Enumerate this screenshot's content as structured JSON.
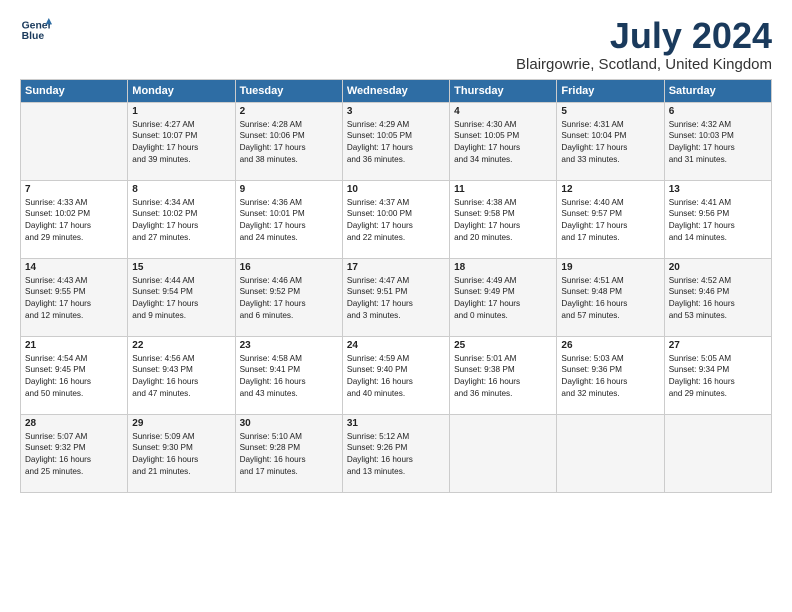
{
  "logo": {
    "line1": "General",
    "line2": "Blue"
  },
  "title": "July 2024",
  "location": "Blairgowrie, Scotland, United Kingdom",
  "days_header": [
    "Sunday",
    "Monday",
    "Tuesday",
    "Wednesday",
    "Thursday",
    "Friday",
    "Saturday"
  ],
  "weeks": [
    [
      {
        "day": "",
        "content": ""
      },
      {
        "day": "1",
        "content": "Sunrise: 4:27 AM\nSunset: 10:07 PM\nDaylight: 17 hours\nand 39 minutes."
      },
      {
        "day": "2",
        "content": "Sunrise: 4:28 AM\nSunset: 10:06 PM\nDaylight: 17 hours\nand 38 minutes."
      },
      {
        "day": "3",
        "content": "Sunrise: 4:29 AM\nSunset: 10:05 PM\nDaylight: 17 hours\nand 36 minutes."
      },
      {
        "day": "4",
        "content": "Sunrise: 4:30 AM\nSunset: 10:05 PM\nDaylight: 17 hours\nand 34 minutes."
      },
      {
        "day": "5",
        "content": "Sunrise: 4:31 AM\nSunset: 10:04 PM\nDaylight: 17 hours\nand 33 minutes."
      },
      {
        "day": "6",
        "content": "Sunrise: 4:32 AM\nSunset: 10:03 PM\nDaylight: 17 hours\nand 31 minutes."
      }
    ],
    [
      {
        "day": "7",
        "content": "Sunrise: 4:33 AM\nSunset: 10:02 PM\nDaylight: 17 hours\nand 29 minutes."
      },
      {
        "day": "8",
        "content": "Sunrise: 4:34 AM\nSunset: 10:02 PM\nDaylight: 17 hours\nand 27 minutes."
      },
      {
        "day": "9",
        "content": "Sunrise: 4:36 AM\nSunset: 10:01 PM\nDaylight: 17 hours\nand 24 minutes."
      },
      {
        "day": "10",
        "content": "Sunrise: 4:37 AM\nSunset: 10:00 PM\nDaylight: 17 hours\nand 22 minutes."
      },
      {
        "day": "11",
        "content": "Sunrise: 4:38 AM\nSunset: 9:58 PM\nDaylight: 17 hours\nand 20 minutes."
      },
      {
        "day": "12",
        "content": "Sunrise: 4:40 AM\nSunset: 9:57 PM\nDaylight: 17 hours\nand 17 minutes."
      },
      {
        "day": "13",
        "content": "Sunrise: 4:41 AM\nSunset: 9:56 PM\nDaylight: 17 hours\nand 14 minutes."
      }
    ],
    [
      {
        "day": "14",
        "content": "Sunrise: 4:43 AM\nSunset: 9:55 PM\nDaylight: 17 hours\nand 12 minutes."
      },
      {
        "day": "15",
        "content": "Sunrise: 4:44 AM\nSunset: 9:54 PM\nDaylight: 17 hours\nand 9 minutes."
      },
      {
        "day": "16",
        "content": "Sunrise: 4:46 AM\nSunset: 9:52 PM\nDaylight: 17 hours\nand 6 minutes."
      },
      {
        "day": "17",
        "content": "Sunrise: 4:47 AM\nSunset: 9:51 PM\nDaylight: 17 hours\nand 3 minutes."
      },
      {
        "day": "18",
        "content": "Sunrise: 4:49 AM\nSunset: 9:49 PM\nDaylight: 17 hours\nand 0 minutes."
      },
      {
        "day": "19",
        "content": "Sunrise: 4:51 AM\nSunset: 9:48 PM\nDaylight: 16 hours\nand 57 minutes."
      },
      {
        "day": "20",
        "content": "Sunrise: 4:52 AM\nSunset: 9:46 PM\nDaylight: 16 hours\nand 53 minutes."
      }
    ],
    [
      {
        "day": "21",
        "content": "Sunrise: 4:54 AM\nSunset: 9:45 PM\nDaylight: 16 hours\nand 50 minutes."
      },
      {
        "day": "22",
        "content": "Sunrise: 4:56 AM\nSunset: 9:43 PM\nDaylight: 16 hours\nand 47 minutes."
      },
      {
        "day": "23",
        "content": "Sunrise: 4:58 AM\nSunset: 9:41 PM\nDaylight: 16 hours\nand 43 minutes."
      },
      {
        "day": "24",
        "content": "Sunrise: 4:59 AM\nSunset: 9:40 PM\nDaylight: 16 hours\nand 40 minutes."
      },
      {
        "day": "25",
        "content": "Sunrise: 5:01 AM\nSunset: 9:38 PM\nDaylight: 16 hours\nand 36 minutes."
      },
      {
        "day": "26",
        "content": "Sunrise: 5:03 AM\nSunset: 9:36 PM\nDaylight: 16 hours\nand 32 minutes."
      },
      {
        "day": "27",
        "content": "Sunrise: 5:05 AM\nSunset: 9:34 PM\nDaylight: 16 hours\nand 29 minutes."
      }
    ],
    [
      {
        "day": "28",
        "content": "Sunrise: 5:07 AM\nSunset: 9:32 PM\nDaylight: 16 hours\nand 25 minutes."
      },
      {
        "day": "29",
        "content": "Sunrise: 5:09 AM\nSunset: 9:30 PM\nDaylight: 16 hours\nand 21 minutes."
      },
      {
        "day": "30",
        "content": "Sunrise: 5:10 AM\nSunset: 9:28 PM\nDaylight: 16 hours\nand 17 minutes."
      },
      {
        "day": "31",
        "content": "Sunrise: 5:12 AM\nSunset: 9:26 PM\nDaylight: 16 hours\nand 13 minutes."
      },
      {
        "day": "",
        "content": ""
      },
      {
        "day": "",
        "content": ""
      },
      {
        "day": "",
        "content": ""
      }
    ]
  ]
}
